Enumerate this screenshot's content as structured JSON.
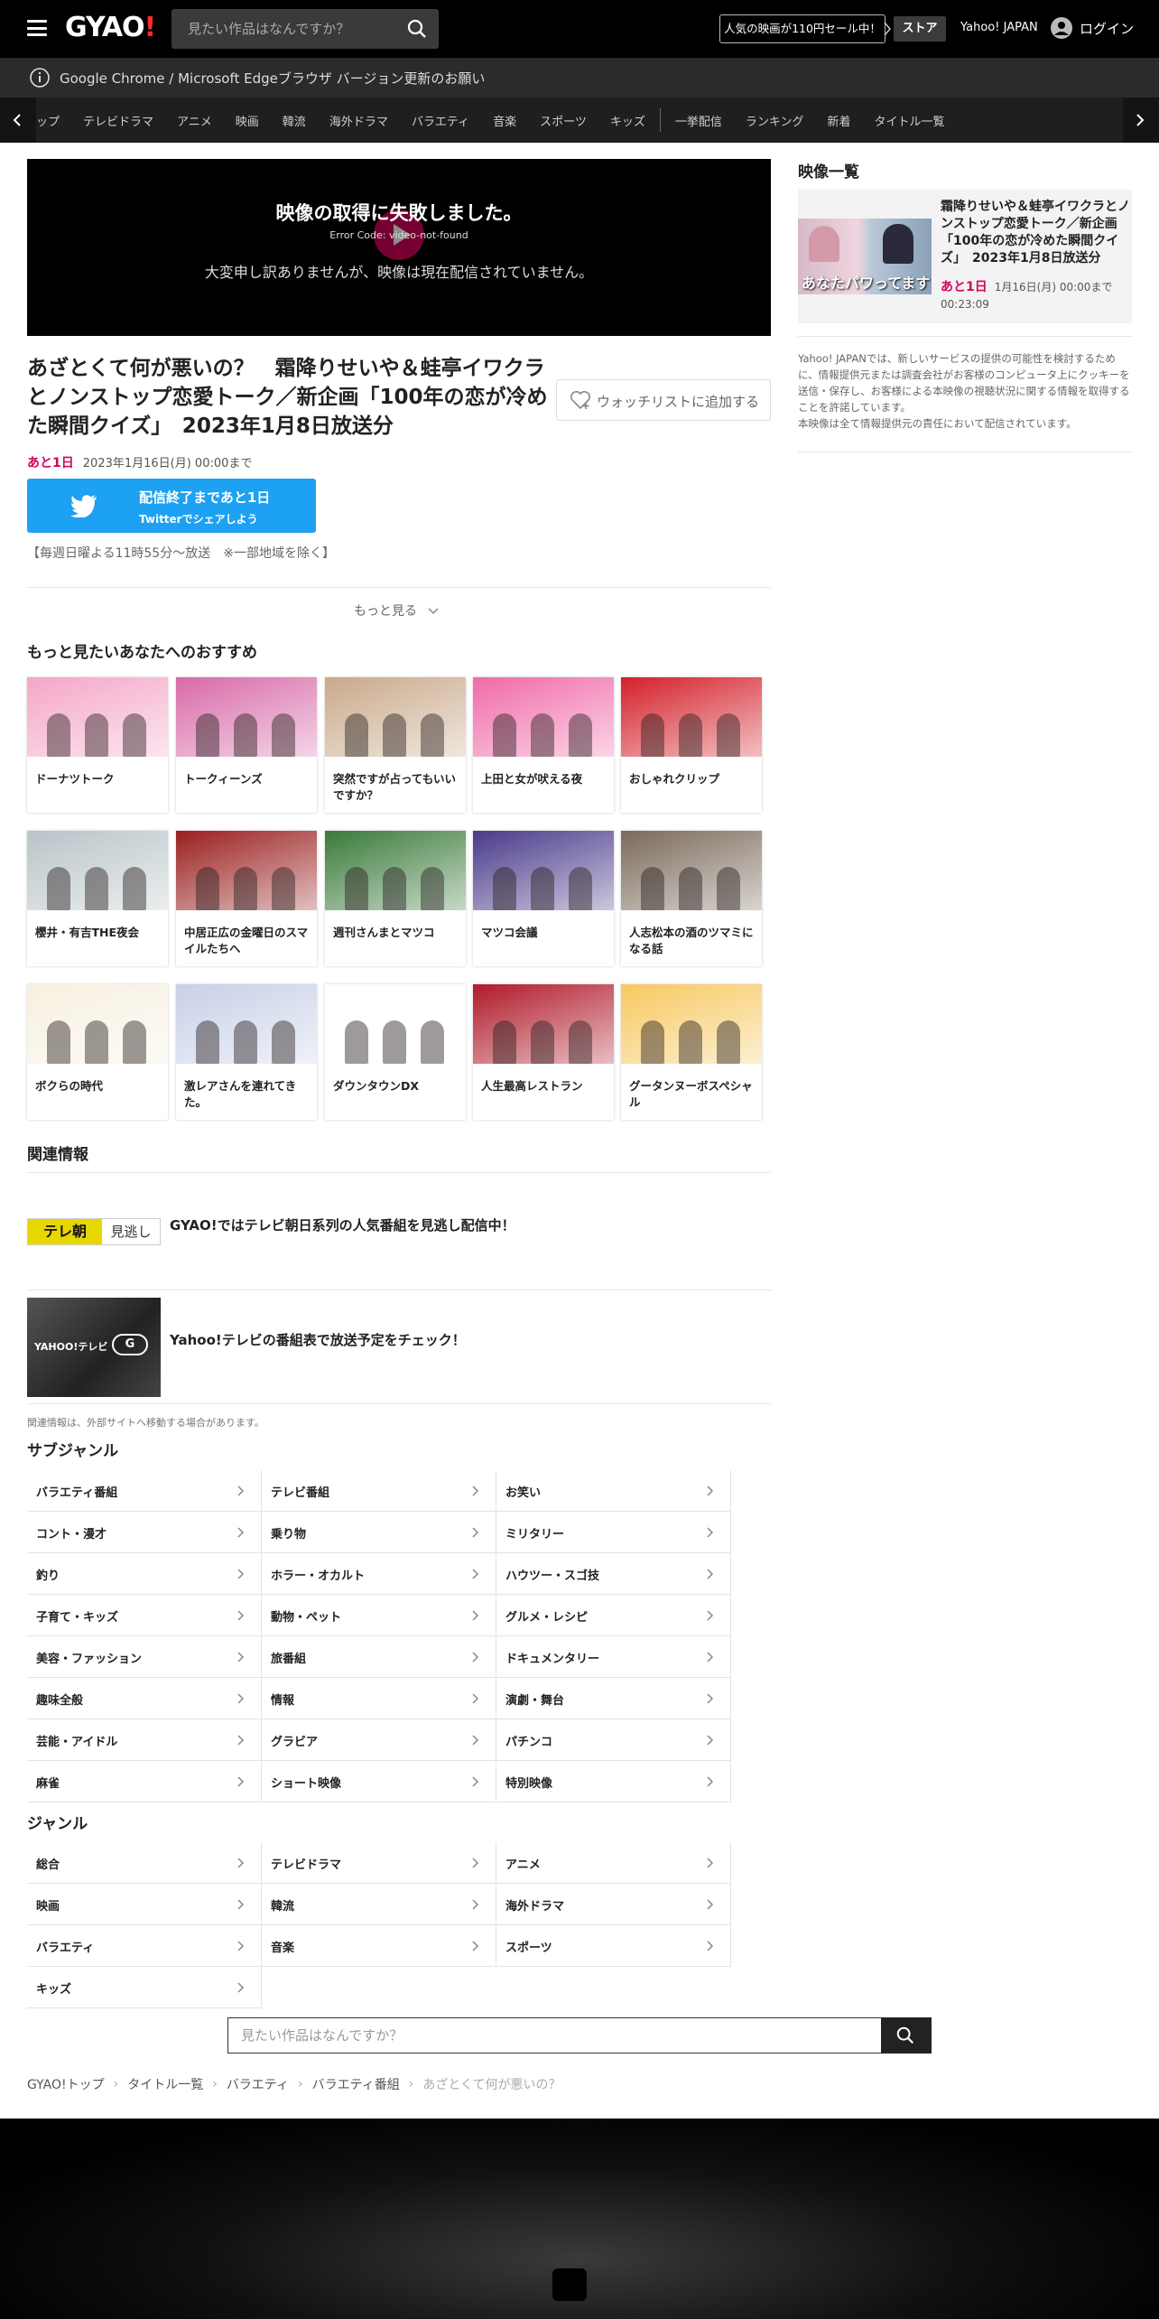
{
  "header": {
    "logo": "GYAO!",
    "search_placeholder": "見たい作品はなんですか？",
    "sale_label": "人気の映画が110円セール中！",
    "store_label": "ストア",
    "yahoo_label": "Yahoo! JAPAN",
    "login_label": "ログイン"
  },
  "notice": "Google Chrome / Microsoft Edgeブラウザ バージョン更新のお願い",
  "categories": [
    "ップ",
    "テレビドラマ",
    "アニメ",
    "映画",
    "韓流",
    "海外ドラマ",
    "バラエティ",
    "音楽",
    "スポーツ",
    "キッズ",
    "一挙配信",
    "ランキング",
    "新着",
    "タイトル一覧"
  ],
  "player": {
    "error_title": "映像の取得に失敗しました。",
    "error_code": "Error Code: video-not-found",
    "error_message": "大変申し訳ありませんが、映像は現在配信されていません。"
  },
  "video": {
    "title": "あざとくて何が悪いの？　霜降りせいや＆蛙亭イワクラとノンストップ恋愛トーク／新企画「100年の恋が冷めた瞬間クイズ」　2023年1月8日放送分",
    "remain": "あと1日",
    "deadline": "2023年1月16日(月) 00:00まで",
    "watchlist_label": "ウォッチリストに追加する",
    "twitter_line1": "配信終了まであと1日",
    "twitter_line2": "Twitterでシェアしよう",
    "broadcast": "【毎週日曜よる11時55分～放送　※一部地域を除く】",
    "more_label": "もっと見る"
  },
  "recommend": {
    "heading": "もっと見たいあなたへのおすすめ",
    "items": [
      {
        "title": "ドーナツトーク",
        "color": "#f4a6c8"
      },
      {
        "title": "トークィーンズ",
        "color": "#d86aa8"
      },
      {
        "title": "突然ですが占ってもいいですか？",
        "color": "#c9a98a"
      },
      {
        "title": "上田と女が吠える夜",
        "color": "#f06aa8"
      },
      {
        "title": "おしゃれクリップ",
        "color": "#d4202a"
      },
      {
        "title": "櫻井・有吉THE夜会",
        "color": "#b9c4c8"
      },
      {
        "title": "中居正広の金曜日のスマイルたちへ",
        "color": "#9a1f1f"
      },
      {
        "title": "週刊さんまとマツコ",
        "color": "#3a7a3a"
      },
      {
        "title": "マツコ会議",
        "color": "#4a3a8a"
      },
      {
        "title": "人志松本の酒のツマミになる話",
        "color": "#7a6a5a"
      },
      {
        "title": "ボクらの時代",
        "color": "#f7f0e0"
      },
      {
        "title": "激レアさんを連れてきた。",
        "color": "#c8d0e8"
      },
      {
        "title": "ダウンタウンDX",
        "color": "#ffffff"
      },
      {
        "title": "人生最高レストラン",
        "color": "#b01a2a"
      },
      {
        "title": "グータンヌーボスペシャル",
        "color": "#f7c860"
      }
    ]
  },
  "related": {
    "heading": "関連情報",
    "items": [
      {
        "title": "GYAO!ではテレビ朝日系列の人気番組を見逃し配信中！",
        "logo_a": "テレ朝",
        "logo_b": "見逃し"
      },
      {
        "title": "Yahoo!テレビの番組表で放送予定をチェック！",
        "logo_a": "YAHOO!テレビ",
        "logo_b": "G"
      }
    ],
    "note": "関連情報は、外部サイトへ移動する場合があります。"
  },
  "subgenre": {
    "heading": "サブジャンル",
    "items": [
      "バラエティ番組",
      "テレビ番組",
      "お笑い",
      "コント・漫才",
      "乗り物",
      "ミリタリー",
      "釣り",
      "ホラー・オカルト",
      "ハウツー・スゴ技",
      "子育て・キッズ",
      "動物・ペット",
      "グルメ・レシピ",
      "美容・ファッション",
      "旅番組",
      "ドキュメンタリー",
      "趣味全般",
      "情報",
      "演劇・舞台",
      "芸能・アイドル",
      "グラビア",
      "パチンコ",
      "麻雀",
      "ショート映像",
      "特別映像"
    ]
  },
  "genre": {
    "heading": "ジャンル",
    "items": [
      "総合",
      "テレビドラマ",
      "アニメ",
      "映画",
      "韓流",
      "海外ドラマ",
      "バラエティ",
      "音楽",
      "スポーツ",
      "キッズ"
    ]
  },
  "bottom_search_placeholder": "見たい作品はなんですか？",
  "breadcrumbs": [
    "GYAO!トップ",
    "タイトル一覧",
    "バラエティ",
    "バラエティ番組",
    "あざとくて何が悪いの？"
  ],
  "sidebar": {
    "heading": "映像一覧",
    "card_title": "霜降りせいや＆蛙亭イワクラとノンストップ恋愛トーク／新企画「100年の恋が冷めた瞬間クイズ」　2023年1月8日放送分",
    "card_remain": "あと1日",
    "card_deadline": "1月16日(月) 00:00まで",
    "card_duration": "00:23:09",
    "card_thumb_text": "あなたパワってます",
    "note": "Yahoo! JAPANでは、新しいサービスの提供の可能性を検討するために、情報提供元または調査会社がお客様のコンピュータ上にクッキーを送信・保存し、お客様による本映像の視聴状況に関する情報を取得することを許諾しています。\n本映像は全て情報提供元の責任において配信されています。"
  },
  "colors": {
    "accent": "#d6005b",
    "twitter": "#1da1f2",
    "header_bg": "#000000"
  }
}
